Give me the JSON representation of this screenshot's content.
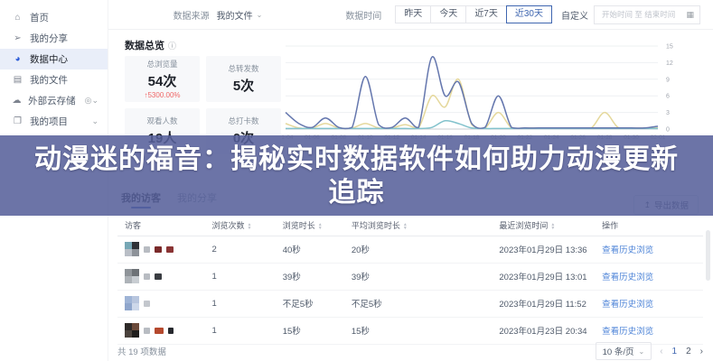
{
  "sidebar": {
    "items": [
      {
        "label": "首页",
        "icon": "home-icon"
      },
      {
        "label": "我的分享",
        "icon": "share-icon"
      },
      {
        "label": "数据中心",
        "icon": "data-center-icon",
        "active": true
      },
      {
        "label": "我的文件",
        "icon": "file-icon"
      },
      {
        "label": "外部云存储",
        "icon": "cloud-icon",
        "badge": true,
        "chevron": true
      },
      {
        "label": "我的项目",
        "icon": "folder-icon",
        "chevron": true
      }
    ]
  },
  "topbar": {
    "source_label": "数据来源",
    "source_value": "我的文件",
    "time_label": "数据时间",
    "ranges": [
      "昨天",
      "今天",
      "近7天",
      "近30天"
    ],
    "selected_range": "近30天",
    "custom_label": "自定义",
    "date_placeholder": "开始时间 至 结束时间"
  },
  "overview": {
    "title": "数据总览",
    "cards": [
      {
        "label": "总浏览量",
        "value": "54次",
        "delta": "↑5300.00%"
      },
      {
        "label": "总转发数",
        "value": "5次"
      },
      {
        "label": "观看人数",
        "value": "19人"
      },
      {
        "label": "总打卡数",
        "value": "0次"
      }
    ]
  },
  "chart_data": {
    "type": "line",
    "smooth": true,
    "x_labels": [
      "01-04",
      "01-06",
      "01-08",
      "01-10",
      "01-12",
      "01-14",
      "01-16",
      "01-18",
      "01-20",
      "01-22",
      "01-24",
      "01-26",
      "01-28",
      "01-30",
      "02-01"
    ],
    "yticks": [
      0,
      3,
      6,
      9,
      12,
      15
    ],
    "ylim": [
      0,
      15
    ],
    "grid": "horizontal",
    "legend": "none",
    "series": [
      {
        "id": "yellow",
        "color": "#e5d89c",
        "values": [
          1,
          0.2,
          0.2,
          1,
          0.2,
          0.2,
          1,
          0.2,
          0.2,
          0.8,
          0.2,
          6,
          4,
          9,
          0.8,
          0.2,
          3,
          0.2,
          0.2,
          0.2,
          0.2,
          0.2,
          0.2,
          0.2,
          3,
          0.3,
          0.2,
          0.2,
          0.2
        ]
      },
      {
        "id": "teal",
        "color": "#82c2cc",
        "values": [
          0.1,
          0.1,
          0.1,
          0.1,
          0.1,
          0.1,
          0.1,
          0.1,
          0.1,
          0.1,
          0.1,
          0.3,
          1.5,
          1,
          0.2,
          0.1,
          0.1,
          0.1,
          0.1,
          0.1,
          0.1,
          0.1,
          0.1,
          0.1,
          0.1,
          0.1,
          0.1,
          0.1,
          0.1
        ]
      },
      {
        "id": "blue",
        "color": "#6577ae",
        "values": [
          3,
          1,
          0.3,
          2,
          0.3,
          0.3,
          9.5,
          0.8,
          0.3,
          2,
          0.3,
          13,
          6,
          8.5,
          1,
          0.3,
          6,
          0.3,
          0.2,
          0.2,
          0.2,
          0.2,
          0.2,
          0.2,
          0.2,
          0.2,
          0.2,
          0.2,
          0.5
        ]
      }
    ]
  },
  "banner": {
    "line1": "动漫迷的福音：揭秘实时数据软件如何助力动漫更新",
    "line2": "追踪"
  },
  "tabs": {
    "items": [
      "我的访客",
      "我的分享"
    ],
    "active": "我的访客",
    "export_label": "导出数据"
  },
  "table": {
    "columns": [
      {
        "label": "访客",
        "sortable": false
      },
      {
        "label": "浏览次数",
        "sortable": true
      },
      {
        "label": "浏览时长",
        "sortable": true
      },
      {
        "label": "平均浏览时长",
        "sortable": true
      },
      {
        "label": "最近浏览时间",
        "sortable": true
      },
      {
        "label": "操作",
        "sortable": false
      }
    ],
    "rows": [
      {
        "avatar": [
          "#76a7b5",
          "#2f3136",
          "#b9bec6",
          "#8d9299"
        ],
        "marks": [
          {
            "c": "#b8bcc2",
            "w": 7
          },
          {
            "c": "#7a2a2a",
            "w": 8
          },
          {
            "c": "#8a3434",
            "w": 8
          }
        ],
        "views": "2",
        "duration": "40秒",
        "avg_duration": "20秒",
        "last_time": "2023年01月29日 13:36",
        "action": "查看历史浏览"
      },
      {
        "avatar": [
          "#8f9499",
          "#6d7277",
          "#aeb3b8",
          "#c8cdd2"
        ],
        "marks": [
          {
            "c": "#b8bcc2",
            "w": 7
          },
          {
            "c": "#3a3d42",
            "w": 8
          }
        ],
        "views": "1",
        "duration": "39秒",
        "avg_duration": "39秒",
        "last_time": "2023年01月29日 13:01",
        "action": "查看历史浏览"
      },
      {
        "avatar": [
          "#9fb4d6",
          "#b8c6de",
          "#8fa6cc",
          "#cdd8ea"
        ],
        "marks": [
          {
            "c": "#c3c7cd",
            "w": 7
          }
        ],
        "views": "1",
        "duration": "不足5秒",
        "avg_duration": "不足5秒",
        "last_time": "2023年01月29日 11:52",
        "action": "查看历史浏览"
      },
      {
        "avatar": [
          "#2e2a28",
          "#6b4a3a",
          "#4a423c",
          "#1f1d1c"
        ],
        "marks": [
          {
            "c": "#b8bcc2",
            "w": 7
          },
          {
            "c": "#b5492e",
            "w": 10
          },
          {
            "c": "#27292e",
            "w": 6
          }
        ],
        "views": "1",
        "duration": "15秒",
        "avg_duration": "15秒",
        "last_time": "2023年01月23日 20:34",
        "action": "查看历史浏览"
      }
    ]
  },
  "footer": {
    "total": "共 19 项数据",
    "page_size": "10 条/页",
    "pages": [
      "1",
      "2"
    ],
    "active_page": "1",
    "prev": "‹",
    "next": "›"
  }
}
